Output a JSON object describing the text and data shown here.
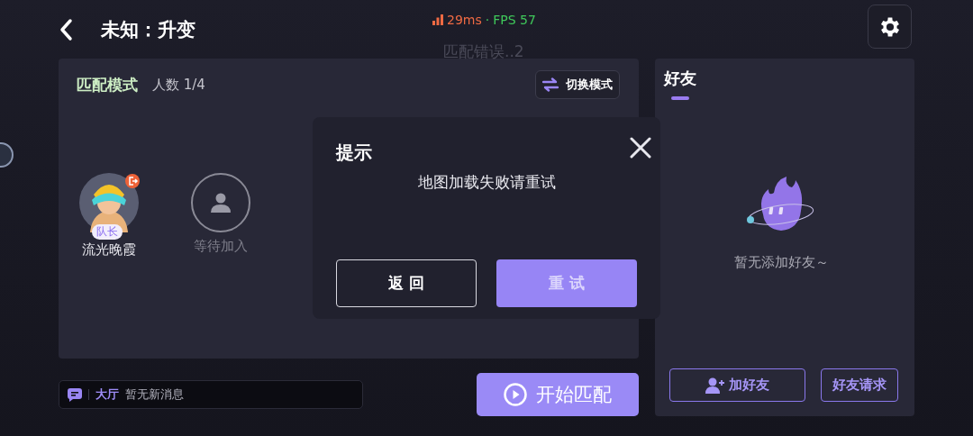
{
  "header": {
    "title": "未知：升变"
  },
  "status": {
    "ping": "29ms",
    "separator": "·",
    "fps": "FPS 57"
  },
  "toast": "匹配错误..2",
  "match_panel": {
    "title": "匹配模式",
    "count": "人数 1/4",
    "switch_button": "切换模式",
    "slots": [
      {
        "kind": "member",
        "name": "流光晚霞",
        "badge": "队长"
      },
      {
        "kind": "empty",
        "name": "等待加入"
      }
    ]
  },
  "chat": {
    "channel": "大厅",
    "message": "暂无新消息"
  },
  "start_button": "开始匹配",
  "friends": {
    "tabs": [
      {
        "label": "好友",
        "selected": true
      }
    ],
    "empty_text": "暂无添加好友～",
    "buttons": [
      {
        "kind": "add",
        "label": "加好友"
      },
      {
        "kind": "requests",
        "label": "好友请求"
      }
    ]
  },
  "dialog": {
    "title": "提示",
    "message": "地图加载失败请重试",
    "buttons": [
      {
        "kind": "secondary",
        "label": "返回"
      },
      {
        "kind": "primary",
        "label": "重试"
      }
    ]
  }
}
